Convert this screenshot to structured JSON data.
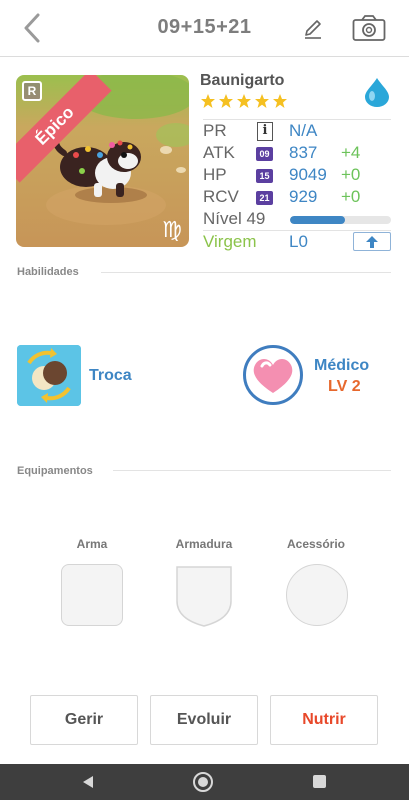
{
  "header": {
    "title": "09+15+21",
    "back_icon": "chevron-left-icon",
    "edit_icon": "pencil-icon",
    "camera_icon": "camera-icon"
  },
  "pet": {
    "name": "Baunigarto",
    "rarity": "Épico",
    "rarity_badge": "R",
    "zodiac_glyph": "♍",
    "stars": 5,
    "element": "water",
    "element_icon": "water-drop-icon"
  },
  "stats": [
    {
      "label": "PR",
      "badge": "i",
      "value": "N/A",
      "bonus": ""
    },
    {
      "label": "ATK",
      "badge": "09",
      "value": "837",
      "bonus": "+4"
    },
    {
      "label": "HP",
      "badge": "15",
      "value": "9049",
      "bonus": "+0"
    },
    {
      "label": "RCV",
      "badge": "21",
      "value": "929",
      "bonus": "+0"
    }
  ],
  "level": {
    "label": "Nível 49",
    "progress": 0.54
  },
  "sign": {
    "label": "Virgem",
    "value": "L0",
    "upgrade_icon": "arrow-up-icon"
  },
  "skills_section": {
    "title": "Habilidades",
    "active": {
      "name": "Troca",
      "icon": "swap-icon"
    },
    "leader": {
      "name": "Médico",
      "level": "LV 2",
      "icon": "heart-icon"
    }
  },
  "equip_section": {
    "title": "Equipamentos",
    "slots": [
      {
        "label": "Arma",
        "icon": "weapon-slot-icon"
      },
      {
        "label": "Armadura",
        "icon": "armor-slot-icon"
      },
      {
        "label": "Acessório",
        "icon": "accessory-slot-icon"
      }
    ]
  },
  "actions": {
    "manage": "Gerir",
    "evolve": "Evoluir",
    "feed": "Nutrir"
  },
  "colors": {
    "accent_blue": "#3e86c4",
    "bonus_green": "#6cc35a",
    "level_orange": "#e7682d",
    "feed_red": "#e8482a",
    "epic_ribbon": "#e8606b",
    "virgo_green": "#8bc34a",
    "stat_badge_purple": "#5b3fa0"
  }
}
